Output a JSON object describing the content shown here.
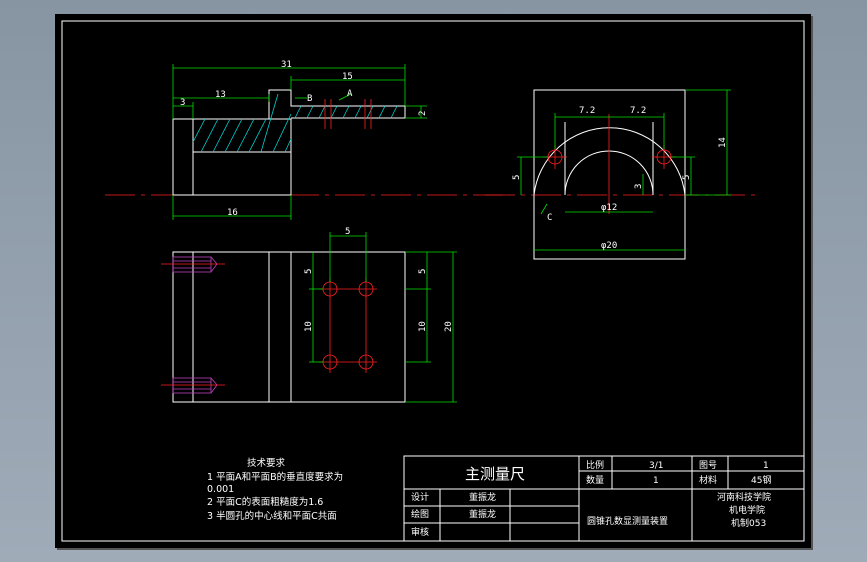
{
  "drawing": {
    "top_view": {
      "dims": {
        "d31": "31",
        "d15": "15",
        "d13": "13",
        "d3": "3",
        "d2": "2",
        "d16": "16"
      },
      "labels": {
        "b": "B",
        "a": "A"
      }
    },
    "right_view": {
      "dims": {
        "d72a": "7.2",
        "d72b": "7.2",
        "d14": "14",
        "d5l": "5",
        "d5r": "5",
        "d3": "3",
        "phi12": "φ12",
        "phi20": "φ20"
      },
      "labels": {
        "c": "C"
      }
    },
    "front_view": {
      "dims": {
        "d5top": "5",
        "d5left": "5",
        "d10left": "10",
        "d5right": "5",
        "d10right": "10",
        "d20": "20"
      }
    }
  },
  "notes": {
    "title": "技术要求",
    "items": [
      "1  平面A和平面B的垂直度要求为",
      "0.001",
      "2  平面C的表面粗糙度为1.6",
      "3  半圆孔的中心线和平面C共面"
    ]
  },
  "title_block": {
    "name": "主测量尺",
    "ratio_label": "比例",
    "ratio_value": "3/1",
    "drawing_no_label": "图号",
    "drawing_no_value": "1",
    "qty_label": "数量",
    "qty_value": "1",
    "material_label": "材料",
    "material_value": "45钢",
    "design_label": "设计",
    "design_value": "董振龙",
    "draw_label": "绘图",
    "draw_value": "董振龙",
    "review_label": "审核",
    "project": "圆锥孔数显测量装置",
    "school_1": "河南科技学院",
    "school_2": "机电学院",
    "class": "机制053"
  }
}
